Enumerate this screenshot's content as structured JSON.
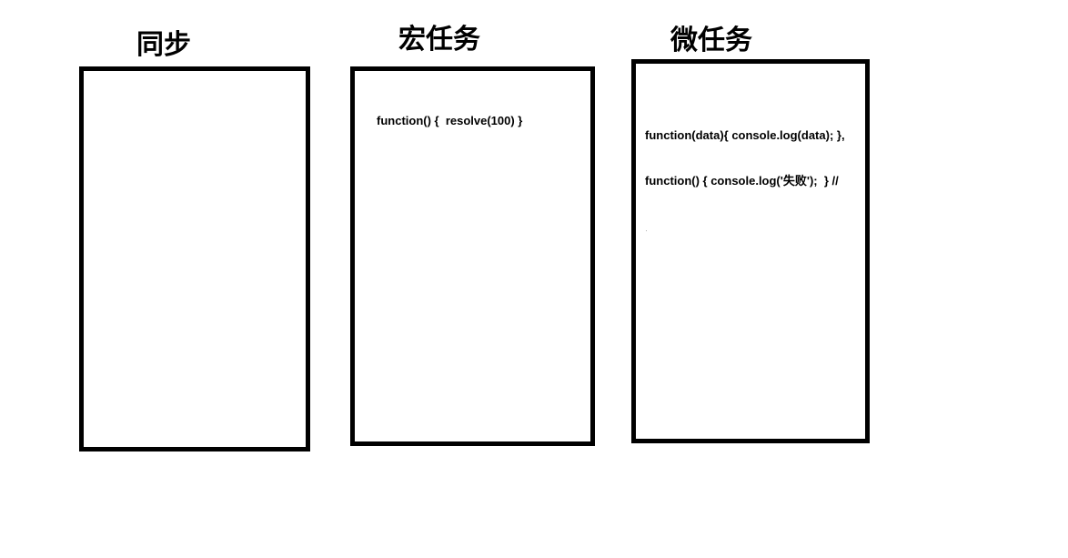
{
  "columns": {
    "sync": {
      "title": "同步"
    },
    "macrotask": {
      "title": "宏任务",
      "lines": [
        "function() {  resolve(100) }"
      ]
    },
    "microtask": {
      "title": "微任务",
      "lines": [
        "function(data){ console.log(data); },",
        "function() { console.log('失败');  } //"
      ]
    }
  },
  "colors": {
    "border": "#000000",
    "background": "#ffffff",
    "text": "#000000"
  }
}
